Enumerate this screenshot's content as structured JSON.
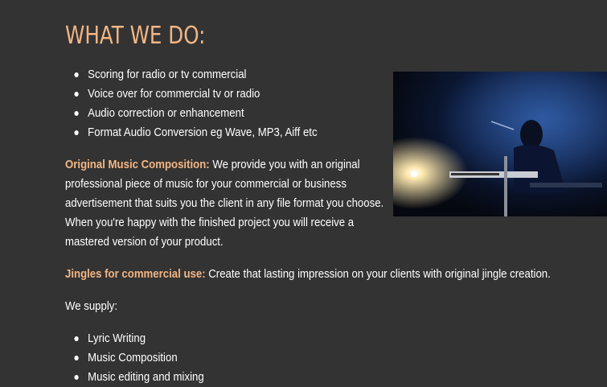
{
  "heading": "WHAT WE DO:",
  "services": [
    "Scoring for radio or tv commercial",
    "Voice over for commercial tv or radio",
    "Audio correction or enhancement",
    "Format Audio Conversion eg Wave, MP3, Aiff etc"
  ],
  "original_music": {
    "label": "Original Music Composition:",
    "lines": [
      "We provide you with an original",
      "professional piece of music for your commercial or business",
      "advertisement that suits you the client in any file format you choose.",
      "When you're happy with the finished project you will receive a",
      "mastered version of your product."
    ]
  },
  "jingles": {
    "label": "Jingles for commercial use:",
    "text": "Create that lasting impression on your clients with original jingle creation."
  },
  "we_supply": "We supply:",
  "supply_items": [
    "Lyric Writing",
    "Music Composition",
    "Music editing and mixing"
  ],
  "colors": {
    "background": "#333333",
    "accent": "#f2b684",
    "text": "#ffffff"
  }
}
